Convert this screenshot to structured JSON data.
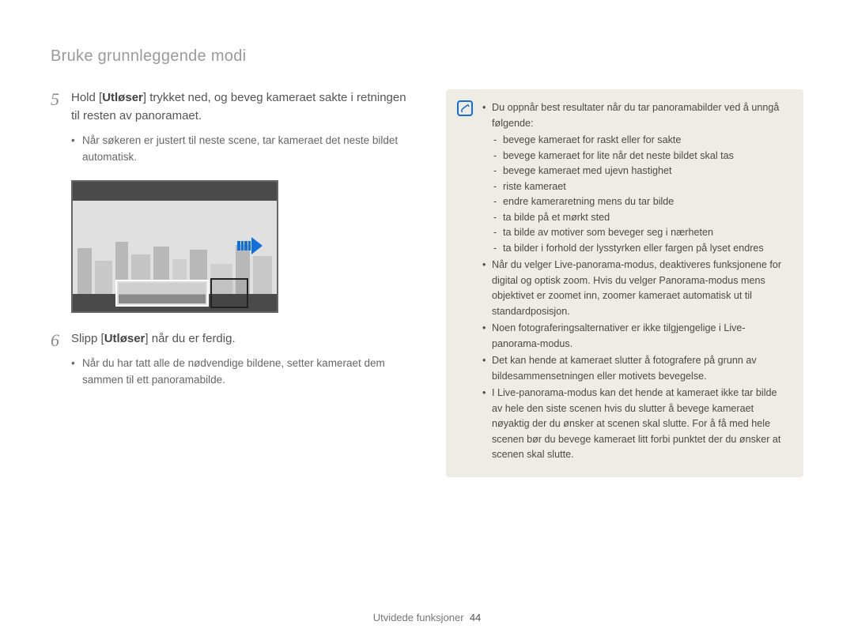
{
  "heading": "Bruke grunnleggende modi",
  "step5": {
    "num": "5",
    "pre": "Hold [",
    "bold": "Utløser",
    "post": "] trykket ned, og beveg kameraet sakte i retningen til resten av panoramaet.",
    "bullet": "Når søkeren er justert til neste scene, tar kameraet det neste bildet automatisk."
  },
  "step6": {
    "num": "6",
    "pre": "Slipp [",
    "bold": "Utløser",
    "post": "] når du er ferdig.",
    "bullet": "Når du har tatt alle de nødvendige bildene, setter kameraet dem sammen til ett panoramabilde."
  },
  "note": {
    "b1": "Du oppnår best resultater når du tar panoramabilder ved å unngå følgende:",
    "d1": "bevege kameraet for raskt eller for sakte",
    "d2": "bevege kameraet for lite når det neste bildet skal tas",
    "d3": "bevege kameraet med ujevn hastighet",
    "d4": "riste kameraet",
    "d5": "endre kameraretning mens du tar bilde",
    "d6": "ta bilde på et mørkt sted",
    "d7": "ta bilde av motiver som beveger seg i nærheten",
    "d8": "ta bilder i forhold der lysstyrken eller fargen på lyset endres",
    "b2": "Når du velger Live-panorama-modus, deaktiveres funksjonene for digital og optisk zoom. Hvis du velger Panorama-modus mens objektivet er zoomet inn, zoomer kameraet automatisk ut til standardposisjon.",
    "b3": "Noen fotograferingsalternativer er ikke tilgjengelige i Live-panorama-modus.",
    "b4": "Det kan hende at kameraet slutter å fotografere på grunn av bildesammensetningen eller motivets bevegelse.",
    "b5": "I Live-panorama-modus kan det hende at kameraet ikke tar bilde av hele den siste scenen hvis du slutter å bevege kameraet nøyaktig der du ønsker at scenen skal slutte. For å få med hele scenen bør du bevege kameraet litt forbi punktet der du ønsker at scenen skal slutte."
  },
  "footer": {
    "label": "Utvidede funksjoner",
    "page": "44"
  }
}
